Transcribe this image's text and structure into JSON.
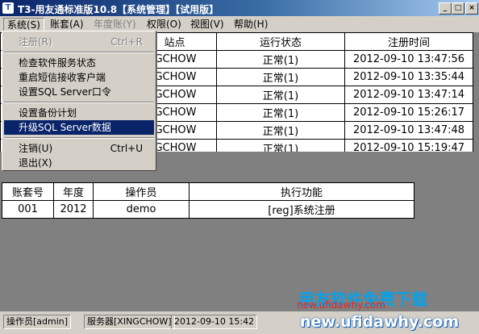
{
  "window": {
    "title": "T3-用友通标准版10.8【系统管理】【试用版】"
  },
  "menubar": [
    {
      "label": "系统(S)",
      "state": "active"
    },
    {
      "label": "账套(A)",
      "state": "normal"
    },
    {
      "label": "年度账(Y)",
      "state": "disabled"
    },
    {
      "label": "权限(O)",
      "state": "normal"
    },
    {
      "label": "视图(V)",
      "state": "normal"
    },
    {
      "label": "帮助(H)",
      "state": "normal"
    }
  ],
  "system_menu": {
    "items": [
      {
        "label": "注册(R)",
        "shortcut": "Ctrl+R",
        "state": "disabled"
      },
      {
        "label": "检查软件服务状态",
        "shortcut": "",
        "state": "normal"
      },
      {
        "label": "重启短信接收客户端",
        "shortcut": "",
        "state": "normal"
      },
      {
        "label": "设置SQL Server口令",
        "shortcut": "",
        "state": "normal"
      },
      {
        "label": "设置备份计划",
        "shortcut": "",
        "state": "normal"
      },
      {
        "label": "升级SQL Server数据",
        "shortcut": "",
        "state": "highlighted"
      },
      {
        "label": "注销(U)",
        "shortcut": "Ctrl+U",
        "state": "normal"
      },
      {
        "label": "退出(X)",
        "shortcut": "",
        "state": "normal"
      }
    ]
  },
  "sessions_table": {
    "columns": [
      "站点",
      "运行状态",
      "注册时间"
    ],
    "rows": [
      [
        "XINGCHOW",
        "正常(1)",
        "2012-09-10 13:47:56"
      ],
      [
        "XINGCHOW",
        "正常(1)",
        "2012-09-10 13:35:44"
      ],
      [
        "XINGCHOW",
        "正常(1)",
        "2012-09-10 13:47:14"
      ],
      [
        "XINGCHOW",
        "正常(1)",
        "2012-09-10 15:26:17"
      ],
      [
        "XINGCHOW",
        "正常(1)",
        "2012-09-10 13:47:48"
      ],
      [
        "XINGCHOW",
        "正常(1)",
        "2012-09-10 15:19:47"
      ]
    ]
  },
  "tasks_table": {
    "columns": [
      "账套号",
      "年度",
      "操作员",
      "执行功能"
    ],
    "rows": [
      [
        "001",
        "2012",
        "demo",
        "[reg]系统注册"
      ]
    ]
  },
  "status_bar": {
    "operator": "操作员[admin]",
    "server": "服务器[XINGCHOW]",
    "datetime": "2012-09-10 15:42"
  },
  "watermark": {
    "slogan": "用友软件免费下载",
    "url": "new.ufidawhy.com",
    "url_overlay": "new.ufidawhy.com"
  }
}
